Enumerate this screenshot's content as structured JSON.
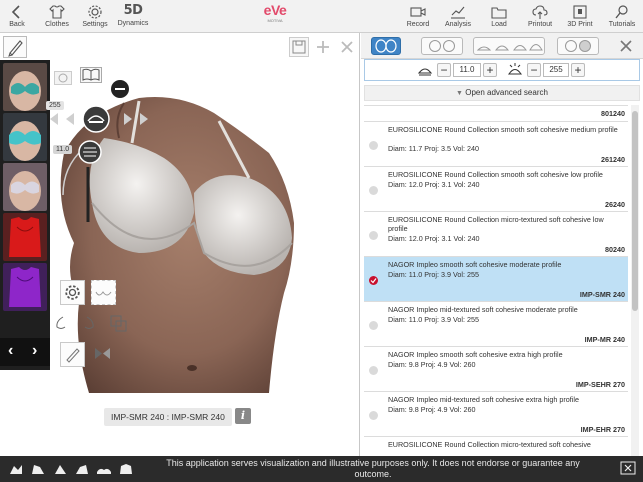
{
  "toolbar": {
    "back": "Back",
    "clothes": "Clothes",
    "settings": "Settings",
    "dynamics_badge": "5D",
    "dynamics": "Dynamics",
    "logo": "eVe",
    "logo_sub": "MOTIVA",
    "record": "Record",
    "analysis": "Analysis",
    "load": "Load",
    "printout": "Printout",
    "print3d": "3D Print",
    "tutorials": "Tutorials"
  },
  "viewer": {
    "left_size": "255",
    "left_diam": "11.0",
    "caption": "IMP-SMR 240 : IMP-SMR 240",
    "info": "i"
  },
  "filters": {
    "diameter_value": "11.0",
    "volume_value": "255",
    "minus": "−",
    "plus": "+",
    "advanced_search": "Open advanced search"
  },
  "implants": {
    "top_code": "801240",
    "items": [
      {
        "name": "EUROSILICONE Round Collection smooth soft cohesive medium profile",
        "meta": "Diam:  11.7 Proj:  3.5 Vol: 240",
        "code": "261240",
        "selected": false
      },
      {
        "name": "EUROSILICONE Round Collection smooth soft cohesive low profile",
        "meta": "Diam:  12.0 Proj:  3.1 Vol: 240",
        "code": "26240",
        "selected": false
      },
      {
        "name": "EUROSILICONE Round Collection micro-textured soft cohesive low profile",
        "meta": "Diam:  12.0 Proj:  3.1 Vol: 240",
        "code": "80240",
        "selected": false
      },
      {
        "name": "NAGOR Impleo smooth soft cohesive moderate profile",
        "meta": "Diam:  11.0 Proj:  3.9 Vol: 255",
        "code": "IMP-SMR 240",
        "selected": true
      },
      {
        "name": "NAGOR Impleo mid-textured soft cohesive moderate profile",
        "meta": "Diam:  11.0 Proj:  3.9 Vol: 255",
        "code": "IMP-MR 240",
        "selected": false
      },
      {
        "name": "NAGOR Impleo smooth soft cohesive extra high profile",
        "meta": "Diam:   9.8 Proj:  4.9 Vol: 260",
        "code": "IMP-SEHR 270",
        "selected": false
      },
      {
        "name": "NAGOR Impleo mid-textured soft cohesive extra high profile",
        "meta": "Diam:   9.8 Proj:  4.9 Vol: 260",
        "code": "IMP-EHR 270",
        "selected": false
      },
      {
        "name": "EUROSILICONE Round Collection micro-textured soft cohesive",
        "meta": "",
        "code": "",
        "selected": false
      }
    ]
  },
  "footer": {
    "disclaimer": "This application serves visualization and illustrative purposes only. It does not endorse or guarantee any outcome."
  },
  "colors": {
    "accent": "#3f84c6",
    "selected_row": "#bfe0f5",
    "selected_check": "#c8102e",
    "footer_bg": "#2b2b2b"
  }
}
